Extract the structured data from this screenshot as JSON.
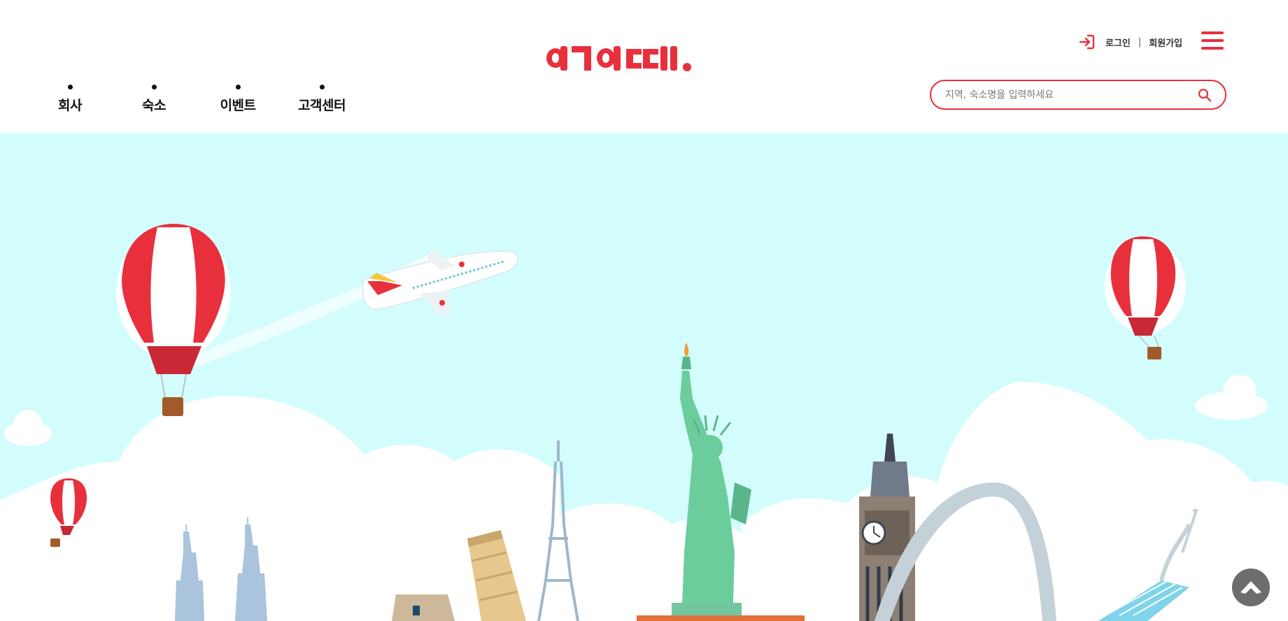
{
  "logo": {
    "text": "여기어때."
  },
  "util": {
    "login": "로그인",
    "separator": "|",
    "signup": "회원가입"
  },
  "nav": [
    {
      "label": "회사"
    },
    {
      "label": "숙소"
    },
    {
      "label": "이벤트"
    },
    {
      "label": "고객센터"
    }
  ],
  "search": {
    "placeholder": "지역, 숙소명을 입력하세요",
    "value": ""
  },
  "colors": {
    "brand": "#e8303d",
    "sky": "#d3fdfd",
    "text": "#111111",
    "top_button": "#6d6d6d"
  },
  "icons": {
    "login": "login-arrow-icon",
    "menu": "hamburger-menu-icon",
    "search": "search-icon",
    "top": "chevron-up-icon"
  }
}
